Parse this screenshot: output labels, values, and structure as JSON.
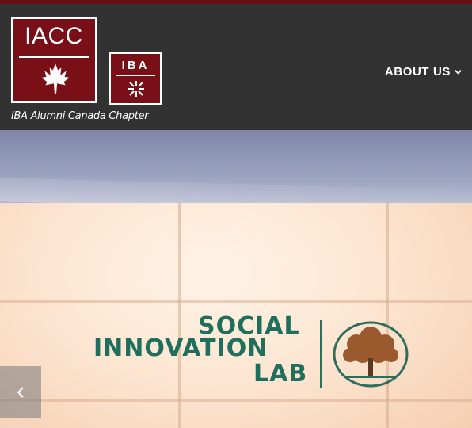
{
  "branding": {
    "iacc_logo_text": "IACC",
    "iba_logo_text": "IBA",
    "tagline": "IBA Alumni Canada Chapter"
  },
  "nav": {
    "about_label": "ABOUT US"
  },
  "hero": {
    "sign_line1": "SOCIAL",
    "sign_line2": "INNOVATION",
    "sign_line3": "LAB"
  },
  "colors": {
    "brand_maroon": "#7a1017",
    "header_bg": "#323232",
    "topbar": "#6b0e14"
  },
  "icons": {
    "maple": "maple-leaf-icon",
    "iba_mark": "iba-mark-icon",
    "chevron": "chevron-down-icon",
    "prev": "chevron-left-icon"
  }
}
